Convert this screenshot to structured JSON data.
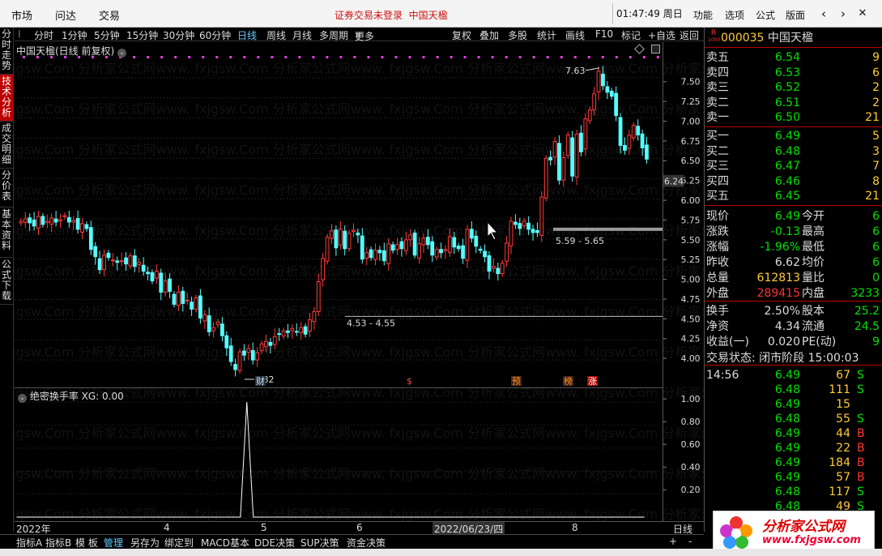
{
  "top_menu": [
    "市场",
    "问达",
    "交易"
  ],
  "notice": "证券交易未登录",
  "notice_stock": "中国天楹",
  "clock": "01:47:49 周日",
  "right_menu": [
    "功能",
    "选项",
    "公式",
    "版面"
  ],
  "side_tabs": [
    "分时走势",
    "技术分析",
    "成交明细",
    "分价表",
    "基本资料",
    "公式下载"
  ],
  "period_tabs": [
    "分时",
    "1分钟",
    "5分钟",
    "15分钟",
    "30分钟",
    "60分钟",
    "日线",
    "周线",
    "月线",
    "多周期",
    "更多"
  ],
  "period_more": "»",
  "tool_tabs": [
    "复权",
    "叠加",
    "多股",
    "统计",
    "画线",
    "F10",
    "标记",
    "+自选",
    "返回"
  ],
  "chart_title": "中国天楹(日线 前复权)",
  "indicator_title": "绝密换手率 XG: 0.00",
  "bottom_tabs": [
    "指标A",
    "指标B",
    "模 板",
    "管理",
    "另存为",
    "绑定到",
    "MACD基本",
    "DDE决策",
    "SUP决策",
    "资金决策"
  ],
  "x_labels": {
    "year": "2022年",
    "m4": "4",
    "m5": "5",
    "m6": "6",
    "date": "2022/06/23/四",
    "m8": "8",
    "period": "日线"
  },
  "annotations": {
    "high": "7.63",
    "low": "3.82",
    "range1": "4.53 - 4.55",
    "range2": "5.59 - 5.65",
    "current": "6.24"
  },
  "event_tags": [
    "财",
    "$",
    "预",
    "榜",
    "涨"
  ],
  "stock": {
    "code": "000035",
    "name": "中国天楹",
    "badge": "R"
  },
  "sell": [
    {
      "label": "卖五",
      "price": "6.54",
      "vol": "9"
    },
    {
      "label": "卖四",
      "price": "6.53",
      "vol": "6"
    },
    {
      "label": "卖三",
      "price": "6.52",
      "vol": "2"
    },
    {
      "label": "卖二",
      "price": "6.51",
      "vol": "2"
    },
    {
      "label": "卖一",
      "price": "6.50",
      "vol": "21"
    }
  ],
  "buy": [
    {
      "label": "买一",
      "price": "6.49",
      "vol": "5"
    },
    {
      "label": "买二",
      "price": "6.48",
      "vol": "3"
    },
    {
      "label": "买三",
      "price": "6.47",
      "vol": "7"
    },
    {
      "label": "买四",
      "price": "6.46",
      "vol": "8"
    },
    {
      "label": "买五",
      "price": "6.45",
      "vol": "21"
    }
  ],
  "quote": [
    {
      "l1": "现价",
      "v1": "6.49",
      "l2": "今开",
      "v2": "6"
    },
    {
      "l1": "涨跌",
      "v1": "-0.13",
      "l2": "最高",
      "v2": "6"
    },
    {
      "l1": "涨幅",
      "v1": "-1.96%",
      "l2": "最低",
      "v2": "6"
    },
    {
      "l1": "昨收",
      "v1": "6.62",
      "l2": "均价",
      "v2": "6"
    },
    {
      "l1": "总量",
      "v1": "612813",
      "l2": "量比",
      "v2": "0"
    },
    {
      "l1": "外盘",
      "v1": "289415",
      "l2": "内盘",
      "v2": "3233"
    },
    {
      "l1": "换手",
      "v1": "2.50%",
      "l2": "股本",
      "v2": "25.2"
    },
    {
      "l1": "净资",
      "v1": "4.34",
      "l2": "流通",
      "v2": "24.5"
    },
    {
      "l1": "收益(一)",
      "v1": "0.020",
      "l2": "PE(动)",
      "v2": "9"
    }
  ],
  "trade_status": "交易状态: 闭市阶段 15:00:03",
  "ticks": [
    {
      "time": "14:56",
      "price": "6.49",
      "vol": "67",
      "side": "S"
    },
    {
      "time": "",
      "price": "6.48",
      "vol": "111",
      "side": "S"
    },
    {
      "time": "",
      "price": "6.49",
      "vol": "15",
      "side": ""
    },
    {
      "time": "",
      "price": "6.48",
      "vol": "55",
      "side": "S"
    },
    {
      "time": "",
      "price": "6.49",
      "vol": "44",
      "side": "B"
    },
    {
      "time": "",
      "price": "6.49",
      "vol": "22",
      "side": "B"
    },
    {
      "time": "",
      "price": "6.49",
      "vol": "184",
      "side": "B"
    },
    {
      "time": "",
      "price": "6.49",
      "vol": "57",
      "side": "B"
    },
    {
      "time": "",
      "price": "6.48",
      "vol": "117",
      "side": "S"
    },
    {
      "time": "",
      "price": "6.48",
      "vol": "49",
      "side": "S"
    }
  ],
  "logo": {
    "name": "分析家公式网",
    "url": "www.fxjgsw.com"
  },
  "watermark": "fxjgsw.Com 分析家公式网www.",
  "colors": {
    "up": "#ff3b3b",
    "down": "#54ffff",
    "flat": "#ffffff",
    "gold": "#ffcc33",
    "green": "#00e000"
  },
  "chart_data": {
    "type": "candlestick",
    "title": "中国天楹(日线 前复权)",
    "ylim": [
      3.8,
      7.8
    ],
    "y_ticks": [
      4.0,
      4.25,
      4.5,
      4.75,
      5.0,
      5.25,
      5.5,
      5.75,
      6.0,
      6.25,
      6.5,
      6.75,
      7.0,
      7.25,
      7.5
    ],
    "closes": [
      5.72,
      5.75,
      5.7,
      5.66,
      5.78,
      5.68,
      5.72,
      5.76,
      5.71,
      5.74,
      5.79,
      5.71,
      5.73,
      5.62,
      5.69,
      5.63,
      5.37,
      5.28,
      5.12,
      5.3,
      5.27,
      5.24,
      5.21,
      5.23,
      5.19,
      5.29,
      5.16,
      5.21,
      5.1,
      5.07,
      4.98,
      5.1,
      4.84,
      4.98,
      4.85,
      4.69,
      4.84,
      4.7,
      4.74,
      4.63,
      4.77,
      4.52,
      4.56,
      4.35,
      4.4,
      4.47,
      4.3,
      4.15,
      3.98,
      3.88,
      4.1,
      4.06,
      4.14,
      4.0,
      4.09,
      4.2,
      4.23,
      4.18,
      4.29,
      4.32,
      4.36,
      4.34,
      4.39,
      4.35,
      4.4,
      4.32,
      4.5,
      4.6,
      4.97,
      5.26,
      5.52,
      5.6,
      5.39,
      5.62,
      5.38,
      5.57,
      5.61,
      5.55,
      5.25,
      5.33,
      5.27,
      5.36,
      5.33,
      5.23,
      5.44,
      5.36,
      5.43,
      5.38,
      5.49,
      5.55,
      5.3,
      5.44,
      5.51,
      5.43,
      5.3,
      5.37,
      5.33,
      5.37,
      5.53,
      5.4,
      5.38,
      5.26,
      5.62,
      5.51,
      5.41,
      5.36,
      5.28,
      5.1,
      5.16,
      5.07,
      5.2,
      5.45,
      5.72,
      5.68,
      5.63,
      5.72,
      5.62,
      5.58,
      5.58,
      6.02,
      6.5,
      6.48,
      6.71,
      6.23,
      6.51,
      6.79,
      6.28,
      6.8,
      6.58,
      6.99,
      7.1,
      7.3,
      7.58,
      7.4,
      7.32,
      7.27,
      7.03,
      6.66,
      6.6,
      6.79,
      6.91,
      6.79,
      6.63,
      6.49
    ],
    "indicator": {
      "name": "绝密换手率",
      "ylim": [
        0,
        1.05
      ],
      "y_ticks": [
        0.2,
        0.4,
        0.6,
        0.8,
        1.0
      ],
      "spike_index": 48,
      "spike_value": 1.0
    }
  }
}
